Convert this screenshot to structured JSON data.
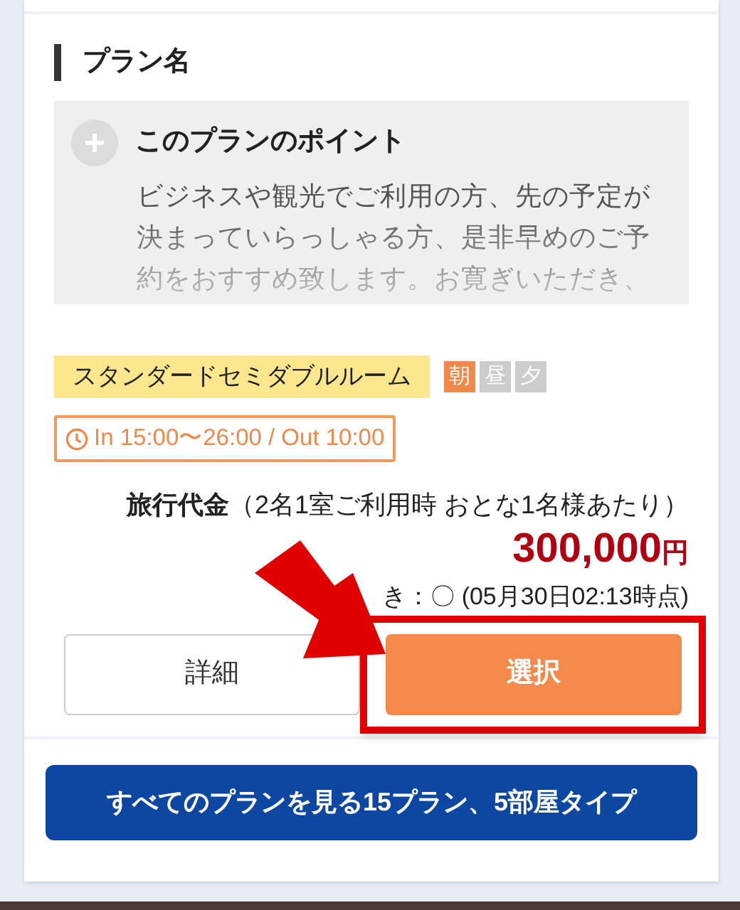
{
  "plan": {
    "title": "プラン名",
    "point": {
      "heading": "このプランのポイント",
      "expanded": false,
      "text": "ビジネスや観光でご利用の方、先の予定が決まっていらっしゃる方、是非早めのご予約をおすすめ致します。お寛ぎいただき、"
    },
    "room_type": "スタンダードセミダブルルーム",
    "meals": [
      {
        "label": "朝",
        "included": true
      },
      {
        "label": "昼",
        "included": false
      },
      {
        "label": "夕",
        "included": false
      }
    ],
    "check_times": "In 15:00〜26:00 / Out 10:00",
    "price_label": "旅行代金",
    "price_note": "（2名1室ご利用時 おとな1名様あたり）",
    "price": "300,000",
    "currency": "円",
    "availability": "き：〇 (05月30日02:13時点)",
    "buttons": [
      {
        "label": "詳細",
        "kind": "secondary",
        "highlighted": false
      },
      {
        "label": "選択",
        "kind": "primary",
        "highlighted": true
      }
    ],
    "all_plans_button": "すべてのプランを見る15プラン、5部屋タイプ"
  }
}
